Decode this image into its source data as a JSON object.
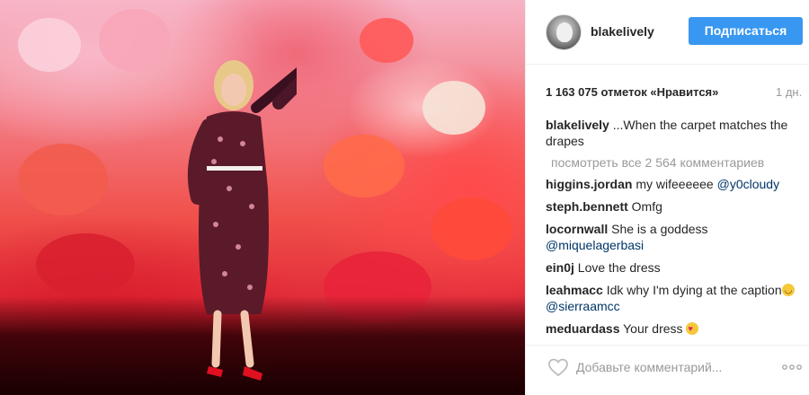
{
  "post": {
    "username": "blakelively",
    "follow_label": "Подписаться",
    "likes": "1 163 075 отметок «Нравится»",
    "time": "1 дн.",
    "caption": {
      "user": "blakelively",
      "text": "...When the carpet matches the drapes"
    },
    "view_all": "посмотреть все 2 564 комментариев",
    "comments": [
      {
        "user": "higgins.jordan",
        "text": "my wifeeeeee ",
        "mention": "@y0cloudy"
      },
      {
        "user": "steph.bennett",
        "text": "Omfg",
        "mention": ""
      },
      {
        "user": "locornwall",
        "text": "She is a goddess ",
        "mention": "@miquelagerbasi"
      },
      {
        "user": "ein0j",
        "text": "Love the dress",
        "mention": ""
      },
      {
        "user": "leahmacc",
        "text": "Idk why I'm dying at the caption",
        "mention": "@sierraamcc"
      },
      {
        "user": "meduardass",
        "text": "Your dress",
        "mention": ""
      }
    ],
    "add_comment_placeholder": "Добавьте комментарий...",
    "icons": {
      "like": "heart-outline-icon",
      "more": "ellipsis-icon",
      "avatar": "avatar"
    },
    "colors": {
      "accent": "#3897f0",
      "mention": "#003569",
      "muted": "#999999"
    }
  }
}
